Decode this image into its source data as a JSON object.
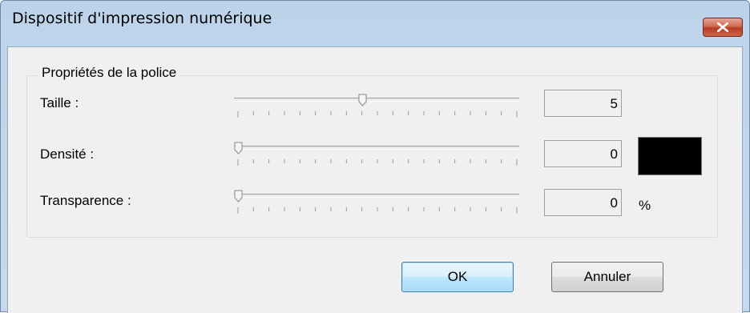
{
  "window": {
    "title": "Dispositif d'impression numérique"
  },
  "close_button": {
    "icon": "close-x-icon"
  },
  "group": {
    "label": "Propriétés de la police"
  },
  "rows": [
    {
      "label": "Taille :",
      "value": "5",
      "slider_fraction": 0.45
    },
    {
      "label": "Densité :",
      "value": "0",
      "slider_fraction": 0.0
    },
    {
      "label": "Transparence :",
      "value": "0",
      "slider_fraction": 0.0
    }
  ],
  "density_color": "#000000",
  "transparency_unit": "%",
  "buttons": {
    "ok": "OK",
    "cancel": "Annuler"
  }
}
